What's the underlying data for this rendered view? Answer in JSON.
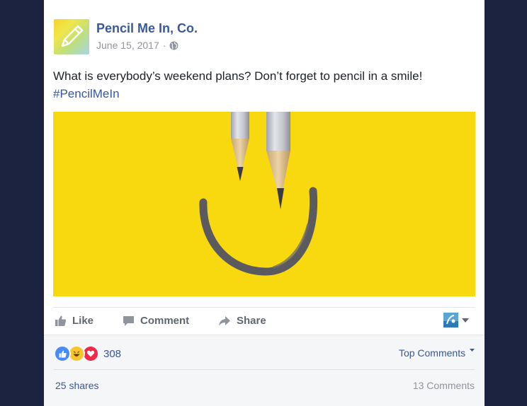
{
  "post": {
    "page_name": "Pencil Me In, Co.",
    "date": "June 15, 2017",
    "meta_separator": "·",
    "text": "What is everybody’s weekend plans? Don’t forget to pencil in a smile!",
    "hashtag": "#PencilMeIn",
    "photo_icon": "smiley-pencils-image"
  },
  "actions": {
    "like": "Like",
    "comment": "Comment",
    "share": "Share"
  },
  "summary": {
    "reaction_icons": [
      "like-icon",
      "haha-icon",
      "love-icon"
    ],
    "reaction_count": "308",
    "top_comments": "Top Comments",
    "shares": "25 shares",
    "comments": "13 Comments"
  },
  "colors": {
    "brand_blue": "#3b5998",
    "link_blue": "#365899",
    "photo_yellow": "#f8d80f",
    "background_navy": "#1c2340"
  }
}
